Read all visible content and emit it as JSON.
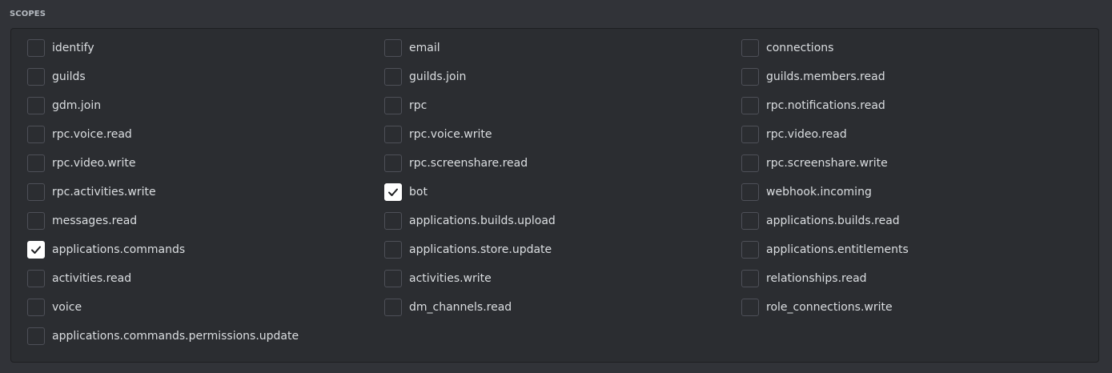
{
  "section": {
    "title": "SCOPES"
  },
  "colors": {
    "background": "#313338",
    "box_background": "#2b2d31",
    "text": "#dbdee1",
    "checked": "#ffffff"
  },
  "scopes": [
    {
      "label": "identify",
      "checked": false
    },
    {
      "label": "email",
      "checked": false
    },
    {
      "label": "connections",
      "checked": false
    },
    {
      "label": "guilds",
      "checked": false
    },
    {
      "label": "guilds.join",
      "checked": false
    },
    {
      "label": "guilds.members.read",
      "checked": false
    },
    {
      "label": "gdm.join",
      "checked": false
    },
    {
      "label": "rpc",
      "checked": false
    },
    {
      "label": "rpc.notifications.read",
      "checked": false
    },
    {
      "label": "rpc.voice.read",
      "checked": false
    },
    {
      "label": "rpc.voice.write",
      "checked": false
    },
    {
      "label": "rpc.video.read",
      "checked": false
    },
    {
      "label": "rpc.video.write",
      "checked": false
    },
    {
      "label": "rpc.screenshare.read",
      "checked": false
    },
    {
      "label": "rpc.screenshare.write",
      "checked": false
    },
    {
      "label": "rpc.activities.write",
      "checked": false
    },
    {
      "label": "bot",
      "checked": true
    },
    {
      "label": "webhook.incoming",
      "checked": false
    },
    {
      "label": "messages.read",
      "checked": false
    },
    {
      "label": "applications.builds.upload",
      "checked": false
    },
    {
      "label": "applications.builds.read",
      "checked": false
    },
    {
      "label": "applications.commands",
      "checked": true
    },
    {
      "label": "applications.store.update",
      "checked": false
    },
    {
      "label": "applications.entitlements",
      "checked": false
    },
    {
      "label": "activities.read",
      "checked": false
    },
    {
      "label": "activities.write",
      "checked": false
    },
    {
      "label": "relationships.read",
      "checked": false
    },
    {
      "label": "voice",
      "checked": false
    },
    {
      "label": "dm_channels.read",
      "checked": false
    },
    {
      "label": "role_connections.write",
      "checked": false
    },
    {
      "label": "applications.commands.permissions.update",
      "checked": false
    }
  ]
}
